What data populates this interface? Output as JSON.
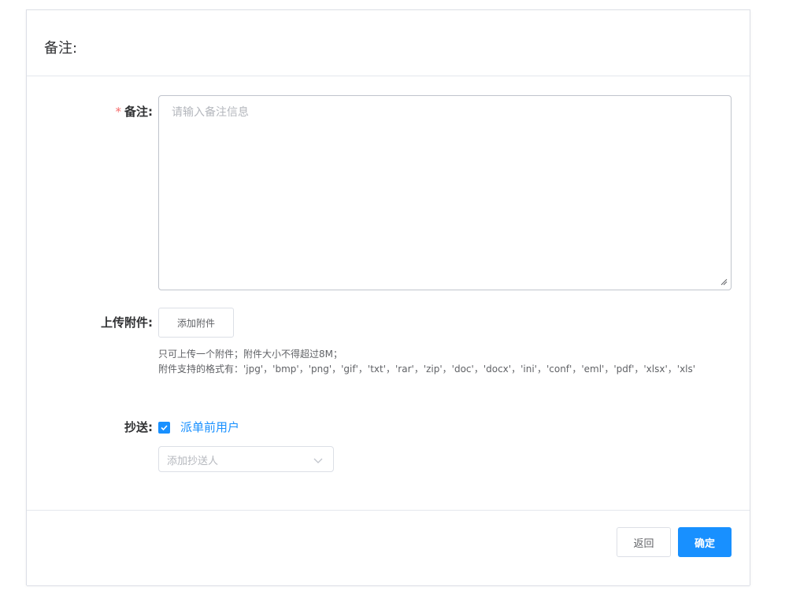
{
  "dialog": {
    "title": "备注:"
  },
  "form": {
    "remark": {
      "required_mark": "*",
      "label": "备注:",
      "placeholder": "请输入备注信息",
      "value": ""
    },
    "attachment": {
      "label": "上传附件:",
      "button_label": "添加附件",
      "tip_line1": "只可上传一个附件；附件大小不得超过8M；",
      "tip_line2": "附件支持的格式有：'jpg'，'bmp'，'png'，'gif'，'txt'，'rar'，'zip'，'doc'，'docx'，'ini'，'conf'，'eml'，'pdf'，'xlsx'，'xls'"
    },
    "cc": {
      "label": "抄送:",
      "checkbox_label": "派单前用户",
      "checked": true,
      "select_placeholder": "添加抄送人"
    }
  },
  "footer": {
    "back_label": "返回",
    "confirm_label": "确定"
  },
  "colors": {
    "primary": "#1890ff",
    "required": "#f56c6c",
    "border": "#dcdfe6"
  },
  "icons": {
    "checkbox": "check-icon",
    "select_arrow": "chevron-down-icon",
    "resize": "resize-handle-icon"
  }
}
